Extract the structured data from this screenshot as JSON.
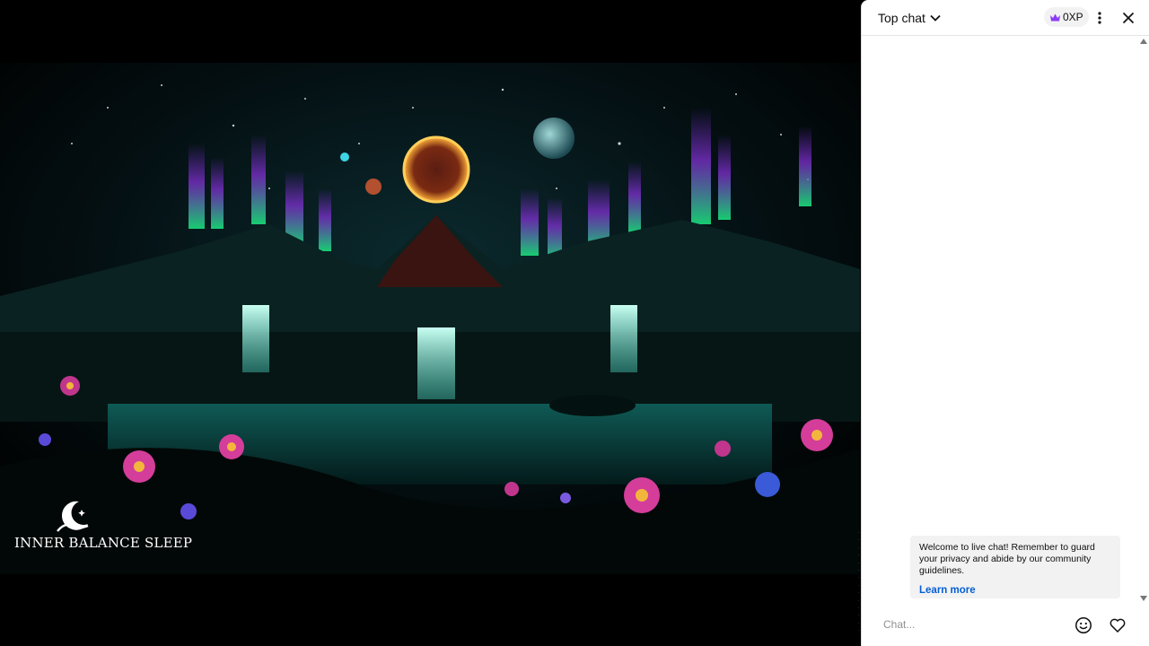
{
  "video": {
    "brand_text": "INNER BALANCE SLEEP"
  },
  "chat": {
    "mode_label": "Top chat",
    "xp_label": "0XP",
    "welcome_message": "Welcome to live chat! Remember to guard your privacy and abide by our community guidelines.",
    "learn_more_label": "Learn more",
    "input_placeholder": "Chat...",
    "colors": {
      "accent_link": "#065fd4",
      "crown": "#8b3cf7",
      "panel_bg": "#ffffff",
      "notice_bg": "#f2f2f2"
    },
    "icons": {
      "mode_dropdown": "chevron-down-icon",
      "xp": "crown-icon",
      "more": "more-vert-icon",
      "close": "close-icon",
      "emoji": "emoji-icon",
      "reaction": "heart-icon"
    }
  }
}
